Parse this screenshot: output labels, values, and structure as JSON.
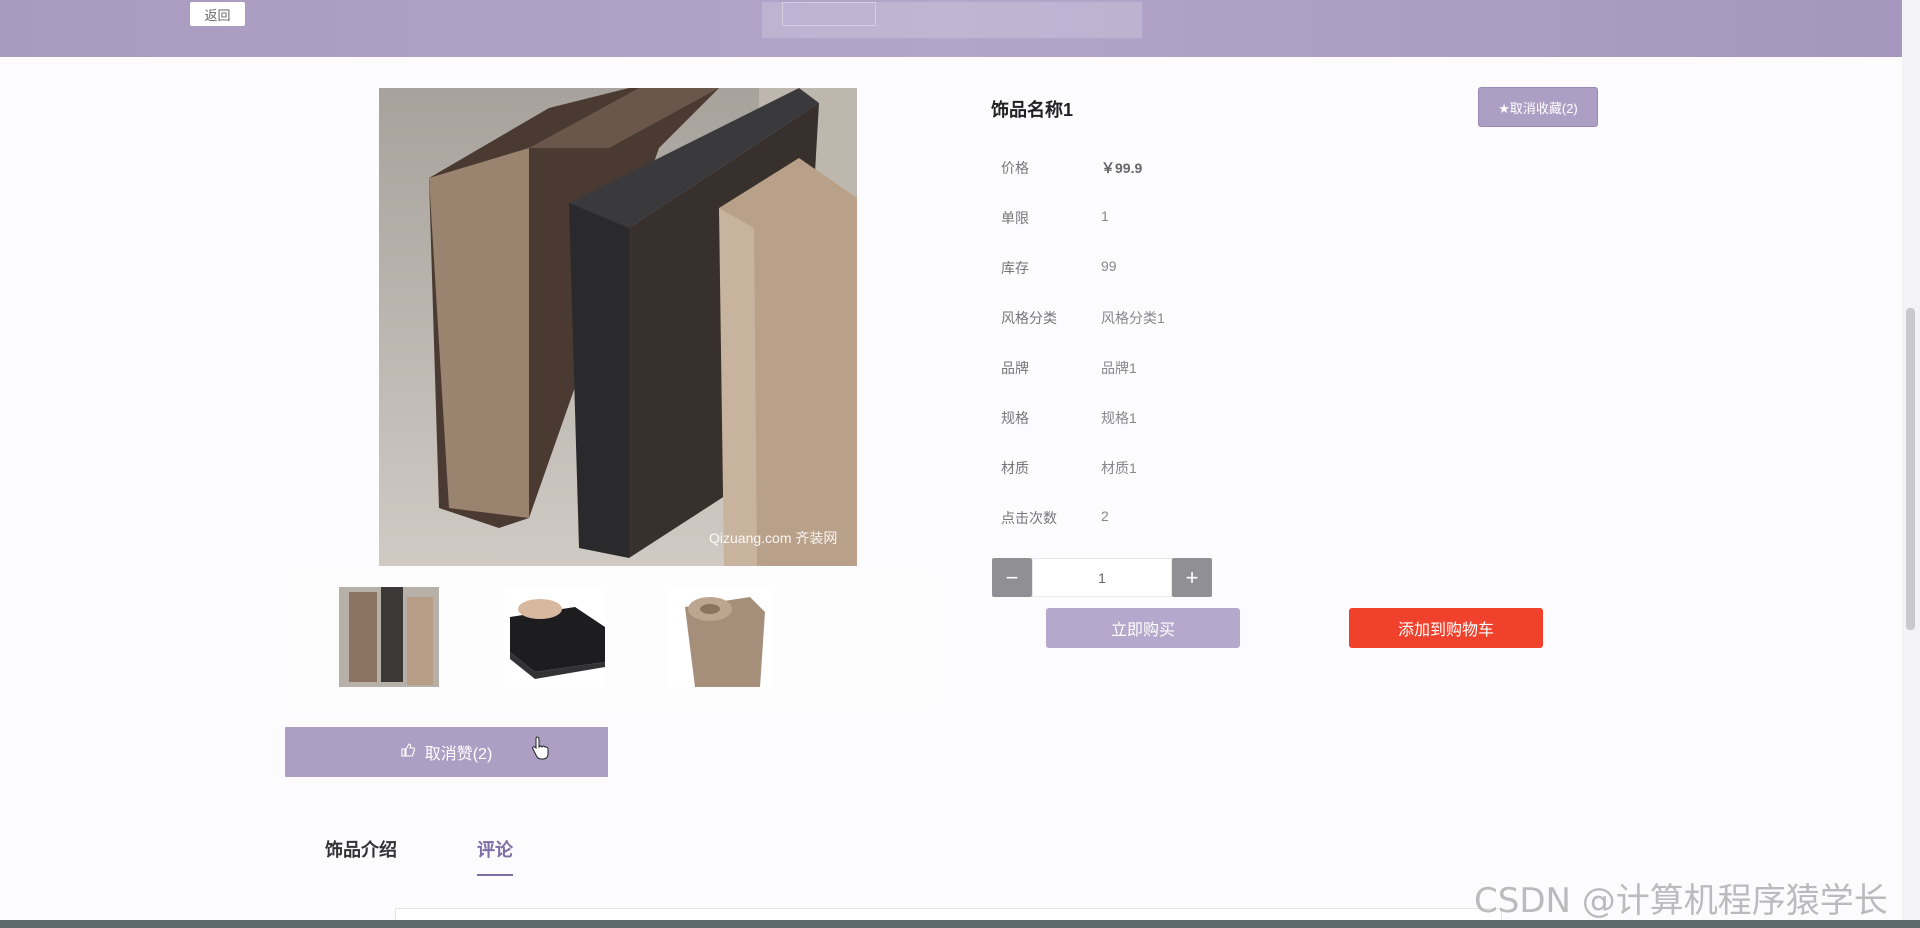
{
  "header": {
    "back_label": "返回"
  },
  "product": {
    "title": "饰品名称1",
    "favorite_label": "★取消收藏(2)",
    "main_image_watermark": "Qizuang.com 齐装网",
    "attributes": [
      {
        "label": "价格",
        "value": "￥99.9"
      },
      {
        "label": "单限",
        "value": "1"
      },
      {
        "label": "库存",
        "value": "99"
      },
      {
        "label": "风格分类",
        "value": "风格分类1"
      },
      {
        "label": "品牌",
        "value": "品牌1"
      },
      {
        "label": "规格",
        "value": "规格1"
      },
      {
        "label": "材质",
        "value": "材质1"
      },
      {
        "label": "点击次数",
        "value": "2"
      }
    ],
    "quantity": "1",
    "quantity_minus": "−",
    "quantity_plus": "+",
    "buy_now_label": "立即购买",
    "add_to_cart_label": "添加到购物车"
  },
  "like": {
    "label": "取消赞(2)"
  },
  "tabs": [
    {
      "label": "饰品介绍"
    },
    {
      "label": "评论"
    }
  ],
  "active_tab": "评论",
  "watermark": "CSDN @计算机程序猿学长",
  "colors": {
    "accent": "#ad9fc4",
    "cart": "#f0412c",
    "tab_active": "#7d6ca5"
  }
}
